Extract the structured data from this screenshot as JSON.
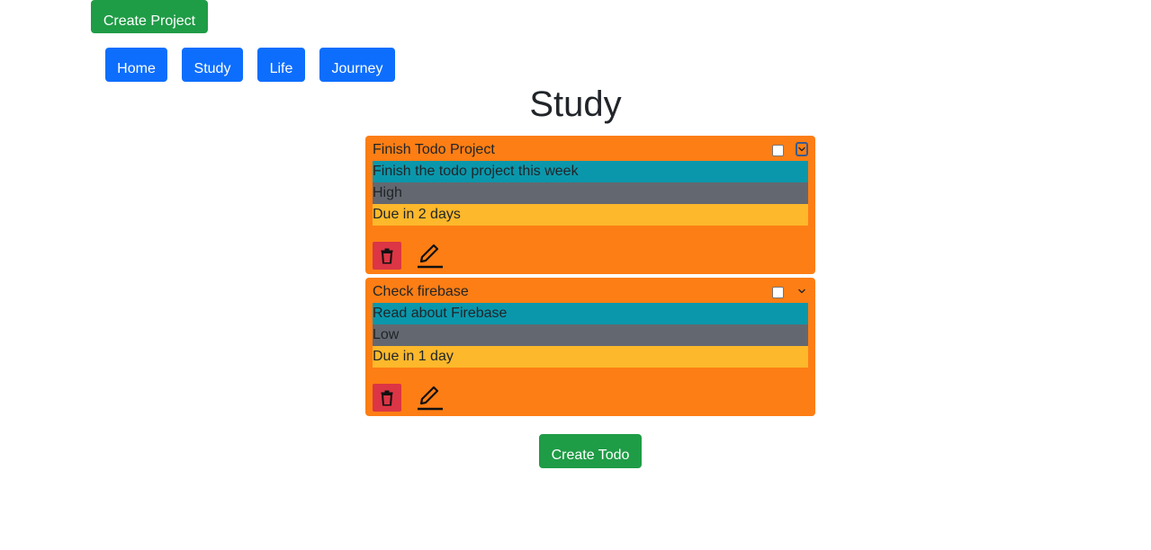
{
  "header": {
    "create_project_label": "Create Project"
  },
  "nav": {
    "items": [
      {
        "label": "Home"
      },
      {
        "label": "Study"
      },
      {
        "label": "Life"
      },
      {
        "label": "Journey"
      }
    ]
  },
  "page": {
    "title": "Study"
  },
  "todos": [
    {
      "title": "Finish Todo Project",
      "description": "Finish the todo project this week",
      "priority": "High",
      "due": "Due in 2 days",
      "completed": false,
      "expanded": true
    },
    {
      "title": "Check firebase",
      "description": "Read about Firebase",
      "priority": "Low",
      "due": "Due in 1 day",
      "completed": false,
      "expanded": false
    }
  ],
  "footer": {
    "create_todo_label": "Create Todo"
  },
  "colors": {
    "success": "#1f9c46",
    "primary": "#0d6efd",
    "card": "#fd7e14",
    "description_row": "#0b97ab",
    "priority_row": "#636870",
    "due_row": "#fdb82b",
    "danger": "#dc3545"
  },
  "icons": {
    "delete": "trash-icon",
    "edit": "pencil-icon",
    "toggle": "chevron-down-icon"
  }
}
